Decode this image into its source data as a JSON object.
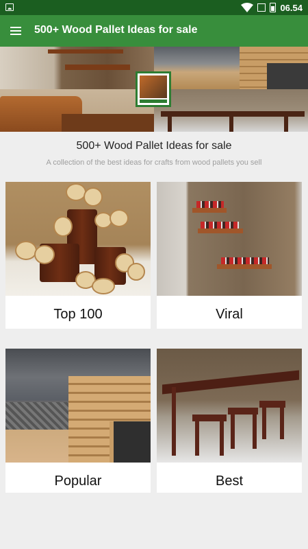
{
  "status_bar": {
    "time": "06.54"
  },
  "app_bar": {
    "title": "500+ Wood Pallet Ideas for sale",
    "menu_icon": "menu-icon"
  },
  "info": {
    "title": "500+ Wood Pallet Ideas for sale",
    "subtitle": "A collection of the best ideas for crafts from wood pallets you sell"
  },
  "categories": [
    {
      "label": "Top 100"
    },
    {
      "label": "Viral"
    },
    {
      "label": "Popular"
    },
    {
      "label": "Best"
    }
  ],
  "colors": {
    "status_bar": "#1b5e20",
    "app_bar": "#388e3c",
    "background": "#eeeeee"
  }
}
